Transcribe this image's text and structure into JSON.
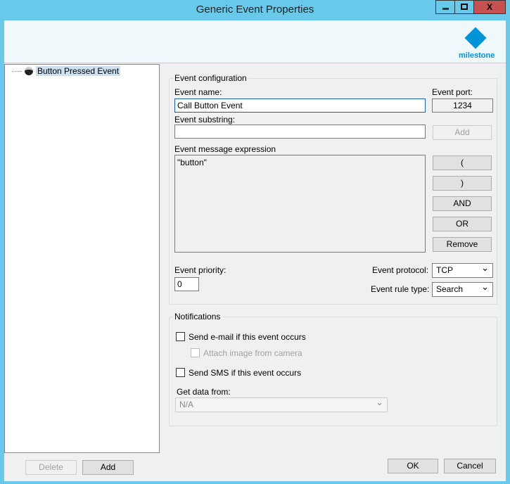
{
  "window": {
    "title": "Generic Event Properties",
    "minimize": "▁",
    "maximize": "☐",
    "close": "X"
  },
  "brand": {
    "name": "milestone",
    "color": "#0093d5"
  },
  "tree": {
    "items": [
      {
        "label": "Button Pressed Event"
      }
    ]
  },
  "left_buttons": {
    "delete": "Delete",
    "add": "Add"
  },
  "config": {
    "group_label": "Event configuration",
    "name_label": "Event name:",
    "name_value": "Call Button Event",
    "port_label": "Event port:",
    "port_value": "1234",
    "substring_label": "Event substring:",
    "substring_value": "",
    "add_label": "Add",
    "expr_label": "Event message expression",
    "expr_value": "\"button\"",
    "ops": [
      "(",
      ")",
      "AND",
      "OR",
      "Remove"
    ],
    "priority_label": "Event priority:",
    "priority_value": "0",
    "protocol_label": "Event protocol:",
    "protocol_value": "TCP",
    "rule_label": "Event rule type:",
    "rule_value": "Search"
  },
  "notifications": {
    "group_label": "Notifications",
    "email": "Send e-mail if this event occurs",
    "attach": "Attach image from camera",
    "sms": "Send SMS if this event occurs",
    "get_data_label": "Get data from:",
    "get_data_value": "N/A"
  },
  "footer": {
    "ok": "OK",
    "cancel": "Cancel"
  }
}
